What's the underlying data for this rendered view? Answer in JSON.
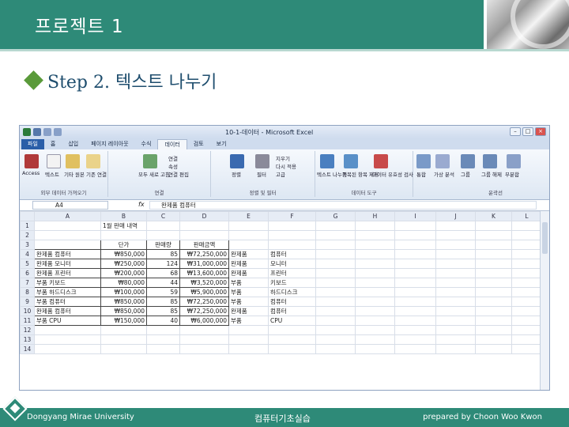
{
  "header": {
    "title": "프로젝트 1"
  },
  "step": {
    "text": "Step 2. 텍스트 나누기"
  },
  "excel": {
    "window_title": "10-1-데이터 - Microsoft Excel",
    "window_controls": [
      "–",
      "□",
      "×"
    ],
    "tabs": [
      "파일",
      "홈",
      "삽입",
      "페이지 레이아웃",
      "수식",
      "데이터",
      "검토",
      "보기"
    ],
    "active_tab": "데이터",
    "ribbon": {
      "group1_label": "외부 데이터 가져오기",
      "group1_btn": "Access",
      "group1_btn2": "텍스트",
      "group1_btn3": "기타 원본",
      "group1_btn4": "기존 연결",
      "group2_label": "연결",
      "group2_btn": "모두 새로 고침",
      "group2_items": [
        "연결",
        "속성",
        "연결 편집"
      ],
      "group3_label": "정렬 및 필터",
      "group3_btn": "정렬",
      "group3_btn2": "필터",
      "group3_items": [
        "지우기",
        "다시 적용",
        "고급"
      ],
      "group4_label": "데이터 도구",
      "group4_btn": "텍스트 나누기",
      "group4_btn2": "중복된 항목 제거",
      "group4_btn3": "데이터 유효성 검사",
      "group5_btn": "통합",
      "group5_btn2": "가상 분석",
      "group6_label": "윤곽선",
      "group6_btn": "그룹",
      "group6_btn2": "그룹 해제",
      "group6_btn3": "부분합"
    },
    "name_box": "A4",
    "fx": "fx",
    "formula_value": "완제품 컴퓨터",
    "columns": [
      "A",
      "B",
      "C",
      "D",
      "E",
      "F",
      "G",
      "H",
      "I",
      "J",
      "K",
      "L"
    ],
    "rows": [
      {
        "n": "1",
        "a": "",
        "b": "1월 판매 내역",
        "c": "",
        "d": "",
        "e": "",
        "f": ""
      },
      {
        "n": "2",
        "a": "",
        "b": "",
        "c": "",
        "d": "",
        "e": "",
        "f": ""
      },
      {
        "n": "3",
        "a": "",
        "b": "단가",
        "c": "판매량",
        "d": "판매금액",
        "e": "",
        "f": ""
      },
      {
        "n": "4",
        "a": "완제품 컴퓨터",
        "b": "₩850,000",
        "c": "85",
        "d": "₩72,250,000",
        "e": "완제품",
        "f": "컴퓨터"
      },
      {
        "n": "5",
        "a": "완제품 모니터",
        "b": "₩250,000",
        "c": "124",
        "d": "₩31,000,000",
        "e": "완제품",
        "f": "모니터"
      },
      {
        "n": "6",
        "a": "완제품 프린터",
        "b": "₩200,000",
        "c": "68",
        "d": "₩13,600,000",
        "e": "완제품",
        "f": "프린터"
      },
      {
        "n": "7",
        "a": "부품 키보드",
        "b": "₩80,000",
        "c": "44",
        "d": "₩3,520,000",
        "e": "부품",
        "f": "키보드"
      },
      {
        "n": "8",
        "a": "부품 하드디스크",
        "b": "₩100,000",
        "c": "59",
        "d": "₩5,900,000",
        "e": "부품",
        "f": "하드디스크"
      },
      {
        "n": "9",
        "a": "부품 컴퓨터",
        "b": "₩850,000",
        "c": "85",
        "d": "₩72,250,000",
        "e": "부품",
        "f": "컴퓨터"
      },
      {
        "n": "10",
        "a": "완제품 컴퓨터",
        "b": "₩850,000",
        "c": "85",
        "d": "₩72,250,000",
        "e": "완제품",
        "f": "컴퓨터"
      },
      {
        "n": "11",
        "a": "부품 CPU",
        "b": "₩150,000",
        "c": "40",
        "d": "₩6,000,000",
        "e": "부품",
        "f": "CPU"
      },
      {
        "n": "12",
        "a": "",
        "b": "",
        "c": "",
        "d": "",
        "e": "",
        "f": ""
      },
      {
        "n": "13",
        "a": "",
        "b": "",
        "c": "",
        "d": "",
        "e": "",
        "f": ""
      },
      {
        "n": "14",
        "a": "",
        "b": "",
        "c": "",
        "d": "",
        "e": "",
        "f": ""
      }
    ]
  },
  "footer": {
    "left": "Dongyang Mirae University",
    "center": "컴퓨터기초실습",
    "right": "prepared by Choon Woo Kwon"
  },
  "colors": {
    "brand": "#2e8a78",
    "step_text": "#1f4e6e",
    "bullet": "#5a9a3a"
  }
}
